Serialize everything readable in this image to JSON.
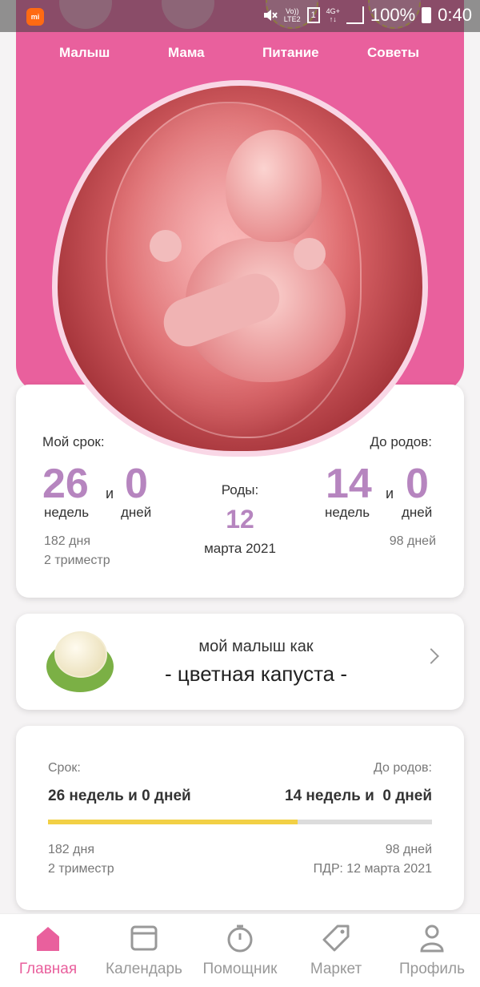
{
  "status_bar": {
    "network_top": "Vo))",
    "network_bottom": "LTE2",
    "sim": "1",
    "data_top": "4G+",
    "data_bottom": "↑↓",
    "battery": "100%",
    "time": "0:40"
  },
  "hero": {
    "tabs": [
      {
        "label": "Малыш"
      },
      {
        "label": "Мама"
      },
      {
        "label": "Питание"
      },
      {
        "label": "Советы"
      }
    ]
  },
  "pregnancy": {
    "my_term_label": "Мой срок:",
    "weeks": "26",
    "and1": "и",
    "days": "0",
    "weeks_unit": "недель",
    "days_unit": "дней",
    "total_days": "182 дня",
    "trimester": "2 триместр",
    "birth_label": "Роды:",
    "birth_day": "12",
    "birth_month_year": "марта 2021",
    "until_label": "До родов:",
    "until_weeks": "14",
    "and2": "и",
    "until_days": "0",
    "until_weeks_unit": "недель",
    "until_days_unit": "дней",
    "until_total_days": "98 дней"
  },
  "baby_size": {
    "subtitle": "мой малыш как",
    "name": "- цветная капуста -"
  },
  "progress": {
    "term_label": "Срок:",
    "term_value": "26 недель и 0 дней",
    "until_label": "До родов:",
    "until_value": "14 недель и  0 дней",
    "progress_fraction": 0.65,
    "total_days": "182 дня",
    "trimester": "2 триместр",
    "until_days": "98 дней",
    "due_date": "ПДР: 12 марта 2021"
  },
  "nav": {
    "items": [
      {
        "label": "Главная",
        "icon": "home-icon",
        "active": true
      },
      {
        "label": "Календарь",
        "icon": "calendar-icon",
        "active": false
      },
      {
        "label": "Помощник",
        "icon": "timer-icon",
        "active": false
      },
      {
        "label": "Маркет",
        "icon": "tag-icon",
        "active": false
      },
      {
        "label": "Профиль",
        "icon": "profile-icon",
        "active": false
      }
    ]
  },
  "colors": {
    "accent_pink": "#e9609d",
    "number_purple": "#b685bf",
    "progress_yellow": "#f2d045"
  }
}
